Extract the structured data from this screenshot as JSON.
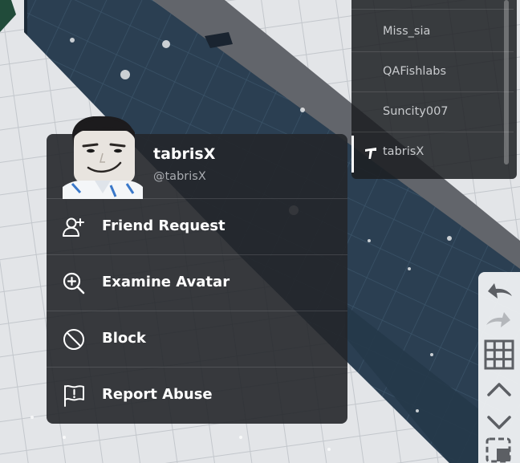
{
  "player_list": {
    "players": [
      {
        "name": "Miss_sia"
      },
      {
        "name": "QAFishlabs"
      },
      {
        "name": "Suncity007"
      },
      {
        "name": "tabrisX",
        "selected": true,
        "icon": "hammer-icon"
      }
    ]
  },
  "context_menu": {
    "display_name": "tabrisX",
    "username": "@tabrisX",
    "items": [
      {
        "label": "Friend Request",
        "icon": "add-friend-icon"
      },
      {
        "label": "Examine Avatar",
        "icon": "zoom-in-icon"
      },
      {
        "label": "Block",
        "icon": "block-icon"
      },
      {
        "label": "Report Abuse",
        "icon": "flag-icon"
      }
    ]
  },
  "toolbar": {
    "buttons": [
      "undo-icon",
      "redo-icon",
      "grid-icon",
      "chevron-up-icon",
      "chevron-down-icon",
      "select-icon"
    ]
  },
  "colors": {
    "menu_bg": "#24262a",
    "text_primary": "#ffffff",
    "text_secondary": "#a9acb1",
    "toolbar_bg": "#eef0f3"
  }
}
